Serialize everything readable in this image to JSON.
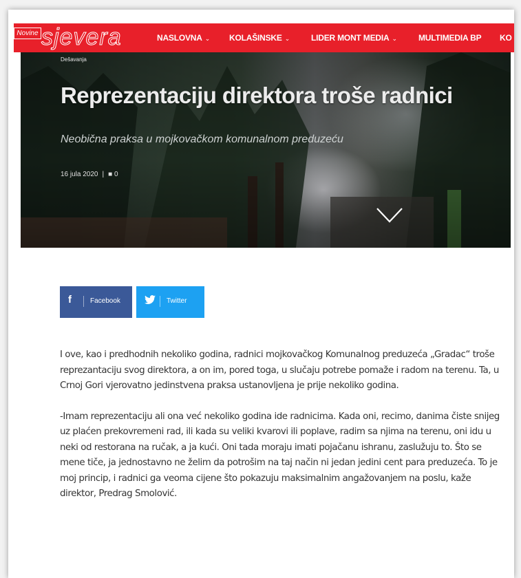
{
  "header": {
    "logo_small": "Novine",
    "logo_big": "sjevera",
    "nav": [
      {
        "label": "NASLOVNA",
        "has_dropdown": true
      },
      {
        "label": "KOLAŠINSKE",
        "has_dropdown": true
      },
      {
        "label": "LIDER MONT MEDIA",
        "has_dropdown": true
      },
      {
        "label": "MULTIMEDIA BP",
        "has_dropdown": false
      },
      {
        "label": "KO",
        "has_dropdown": false
      }
    ],
    "chevron": "⌄"
  },
  "article": {
    "category": "Dešavanja",
    "title": "Reprezentaciju direktora troše radnici",
    "subtitle": "Neobična praksa u mojkovačkom komunalnom preduzeću",
    "date": "16 jula 2020",
    "comment_count": "0"
  },
  "share": {
    "facebook_label": "Facebook",
    "twitter_label": "Twitter"
  },
  "body": {
    "paragraphs": [
      "I ove, kao i predhodnih nekoliko godina, radnici mojkovačkog Komunalnog preduzeća „Gradac“ troše reprezantaciju svog direktora, a on im, pored toga, u slučaju potrebe pomaže i radom na terenu. Ta, u Crnoj Gori vjerovatno jedinstvena praksa ustanovljena je prije nekoliko godina.",
      "-Imam reprezentaciju ali ona već nekoliko godina ide radnicima. Kada oni, recimo, danima čiste snijeg uz plaćen prekovremeni rad, ili kada su veliki kvarovi ili poplave, radim sa njima na terenu, oni idu u neki od restorana na ručak, a ja kući. Oni tada moraju imati pojačanu ishranu, zaslužuju to. Što se mene tiče, ja jednostavno ne želim da potrošim na taj način ni jedan jedini cent para preduzeća. To je moj princip, i radnici ga veoma cijene što pokazuju maksimalnim angažovanjem na poslu, kaže direktor, Predrag Smolović."
    ]
  },
  "colors": {
    "nav_bg": "#e8202a",
    "facebook": "#3b5998",
    "twitter": "#1da1f2"
  }
}
